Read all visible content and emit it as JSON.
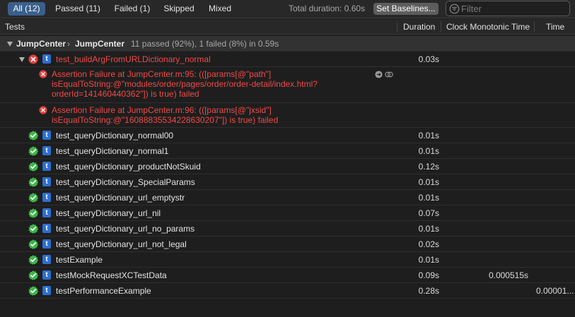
{
  "filterbar": {
    "scopes": [
      {
        "label": "All (12)",
        "active": true
      },
      {
        "label": "Passed (11)",
        "active": false
      },
      {
        "label": "Failed (1)",
        "active": false
      },
      {
        "label": "Skipped",
        "active": false
      },
      {
        "label": "Mixed",
        "active": false
      }
    ],
    "total_duration": "Total duration: 0.60s",
    "set_baselines": "Set Baselines...",
    "filter_placeholder": "Filter",
    "filter_icon": "filter-icon"
  },
  "header": {
    "tests": "Tests",
    "duration": "Duration",
    "clock": "Clock Monotonic Time",
    "time": "Time"
  },
  "group": {
    "name": "JumpCenter",
    "separator": "›",
    "target": "JumpCenter",
    "summary": "11 passed (92%), 1 failed (8%) in 0.59s"
  },
  "failed_test": {
    "name": "test_buildArgFromURLDictionary_normal",
    "duration": "0.03s",
    "badge": "t"
  },
  "failures": [
    {
      "line1": "Assertion Failure at JumpCenter.m:95: (([params[@\"path\"]",
      "line2": "isEqualToString:@\"modules/order/pages/order/order-detail/index.html?",
      "line3": "orderId=141460440362\"]) is true) failed"
    },
    {
      "line1": "Assertion Failure at JumpCenter.m:96: (([params[@\"jxsid\"]",
      "line2": "isEqualToString:@\"16088835534228630207\"]) is true) failed"
    }
  ],
  "tests": [
    {
      "name": "test_queryDictionary_normal00",
      "duration": "0.01s",
      "clock": "",
      "time": ""
    },
    {
      "name": "test_queryDictionary_normal1",
      "duration": "0.01s",
      "clock": "",
      "time": ""
    },
    {
      "name": "test_queryDictionary_productNotSkuid",
      "duration": "0.12s",
      "clock": "",
      "time": ""
    },
    {
      "name": "test_queryDictionary_SpecialParams",
      "duration": "0.01s",
      "clock": "",
      "time": ""
    },
    {
      "name": "test_queryDictionary_url_emptystr",
      "duration": "0.01s",
      "clock": "",
      "time": ""
    },
    {
      "name": "test_queryDictionary_url_nil",
      "duration": "0.07s",
      "clock": "",
      "time": ""
    },
    {
      "name": "test_queryDictionary_url_no_params",
      "duration": "0.01s",
      "clock": "",
      "time": ""
    },
    {
      "name": "test_queryDictionary_url_not_legal",
      "duration": "0.02s",
      "clock": "",
      "time": ""
    },
    {
      "name": "testExample",
      "duration": "0.01s",
      "clock": "",
      "time": ""
    },
    {
      "name": "testMockRequestXCTestData",
      "duration": "0.09s",
      "clock": "0.000515s",
      "time": ""
    },
    {
      "name": "testPerformanceExample",
      "duration": "0.28s",
      "clock": "",
      "time": "0.00001..."
    }
  ],
  "colors": {
    "pass": "#3fb44a",
    "fail": "#e0403c",
    "badge": "#2c6fd0",
    "scope_active": "#3a5f8c"
  }
}
